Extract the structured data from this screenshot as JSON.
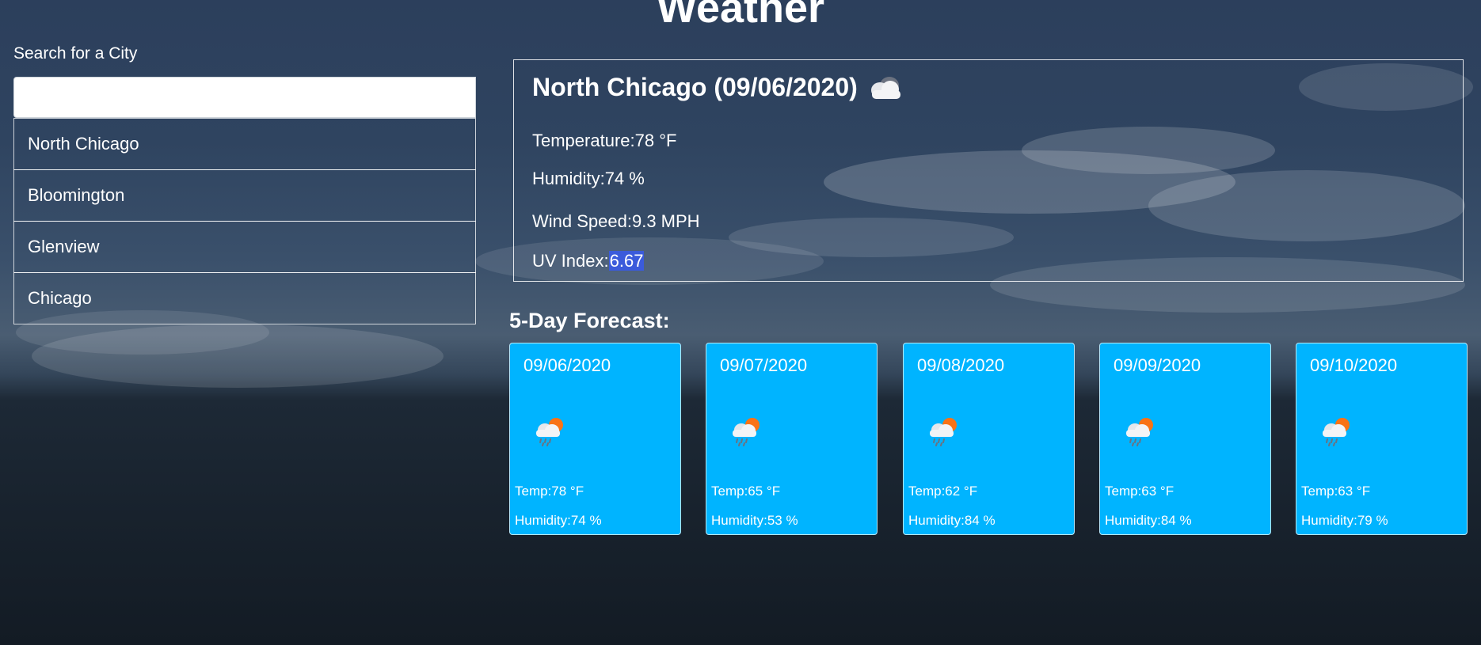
{
  "header": {
    "title": "Weather"
  },
  "search": {
    "label": "Search for a City",
    "value": "",
    "placeholder": ""
  },
  "history": {
    "cities": [
      "North Chicago",
      "Bloomington",
      "Glenview",
      "Chicago"
    ]
  },
  "current": {
    "heading": "North Chicago (09/06/2020)",
    "icon": "cloud-icon",
    "temperature_label": "Temperature:",
    "temperature_value": "78 °F",
    "humidity_label": "Humidity:",
    "humidity_value": "74 %",
    "wind_label": "Wind Speed:",
    "wind_value": "9.3 MPH",
    "uv_label": "UV Index:",
    "uv_value": "6.67"
  },
  "forecast": {
    "title": "5-Day Forecast:",
    "days": [
      {
        "date": "09/06/2020",
        "icon": "rain-cloud-sun-icon",
        "temp": "Temp:78 °F",
        "humidity": "Humidity:74 %"
      },
      {
        "date": "09/07/2020",
        "icon": "rain-cloud-sun-icon",
        "temp": "Temp:65 °F",
        "humidity": "Humidity:53 %"
      },
      {
        "date": "09/08/2020",
        "icon": "rain-cloud-sun-icon",
        "temp": "Temp:62 °F",
        "humidity": "Humidity:84 %"
      },
      {
        "date": "09/09/2020",
        "icon": "rain-cloud-sun-icon",
        "temp": "Temp:63 °F",
        "humidity": "Humidity:84 %"
      },
      {
        "date": "09/10/2020",
        "icon": "rain-cloud-sun-icon",
        "temp": "Temp:63 °F",
        "humidity": "Humidity:79 %"
      }
    ]
  },
  "colors": {
    "card_background": "#00b4ff",
    "uv_highlight": "#3b5bdb"
  }
}
